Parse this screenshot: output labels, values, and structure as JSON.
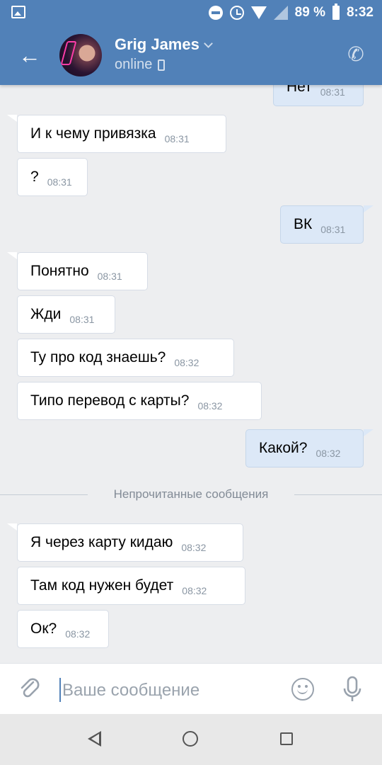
{
  "status_bar": {
    "battery": "89 %",
    "time": "8:32",
    "icons": [
      "gallery-icon",
      "do-not-disturb-icon",
      "alarm-icon",
      "wifi-icon",
      "signal-icon",
      "battery-icon"
    ]
  },
  "header": {
    "contact_name": "Grig James",
    "presence": "online",
    "icons": [
      "back-arrow-icon",
      "chevron-down-icon",
      "mobile-phone-icon",
      "call-icon"
    ]
  },
  "messages": [
    {
      "dir": "out",
      "text": "Нет",
      "time": "08:31"
    },
    {
      "dir": "in",
      "text": "И к чему привязка",
      "time": "08:31"
    },
    {
      "dir": "in",
      "text": "?",
      "time": "08:31"
    },
    {
      "dir": "out",
      "text": "ВК",
      "time": "08:31"
    },
    {
      "dir": "in",
      "text": "Понятно",
      "time": "08:31"
    },
    {
      "dir": "in",
      "text": "Жди",
      "time": "08:31"
    },
    {
      "dir": "in",
      "text": "Ту про код знаешь?",
      "time": "08:32"
    },
    {
      "dir": "in",
      "text": "Типо перевод с карты?",
      "time": "08:32"
    },
    {
      "dir": "out",
      "text": "Какой?",
      "time": "08:32"
    },
    {
      "dir": "in",
      "text": "Я через карту кидаю",
      "time": "08:32"
    },
    {
      "dir": "in",
      "text": "Там код нужен будет",
      "time": "08:32"
    },
    {
      "dir": "in",
      "text": "Ок?",
      "time": "08:32"
    }
  ],
  "unread_divider": "Непрочитанные сообщения",
  "composer": {
    "placeholder": "Ваше сообщение",
    "value": "",
    "icons": [
      "attach-icon",
      "emoji-icon",
      "microphone-icon"
    ]
  },
  "nav_bar": {
    "icons": [
      "nav-back-icon",
      "nav-home-icon",
      "nav-recents-icon"
    ]
  },
  "colors": {
    "header_blue": "#5181b8",
    "chat_background": "#edeef0",
    "incoming_bubble": "#ffffff",
    "outgoing_bubble": "#dce8f7"
  }
}
